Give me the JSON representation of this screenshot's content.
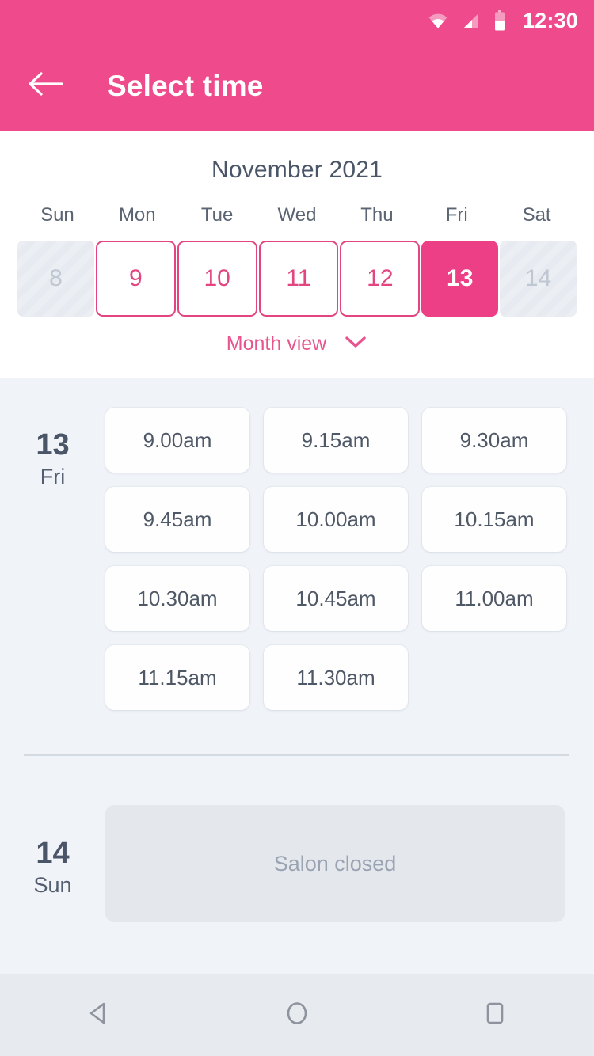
{
  "status_bar": {
    "time": "12:30",
    "icons": [
      "wifi-icon",
      "signal-icon",
      "battery-icon"
    ]
  },
  "app_bar": {
    "back_icon": "back-arrow-icon",
    "title": "Select time"
  },
  "calendar": {
    "month_label": "November 2021",
    "weekdays": [
      "Sun",
      "Mon",
      "Tue",
      "Wed",
      "Thu",
      "Fri",
      "Sat"
    ],
    "days": [
      {
        "number": "8",
        "state": "disabled"
      },
      {
        "number": "9",
        "state": "available"
      },
      {
        "number": "10",
        "state": "available"
      },
      {
        "number": "11",
        "state": "available"
      },
      {
        "number": "12",
        "state": "available"
      },
      {
        "number": "13",
        "state": "selected"
      },
      {
        "number": "14",
        "state": "disabled"
      }
    ],
    "month_view_label": "Month view",
    "month_view_icon": "chevron-down-icon"
  },
  "schedule": {
    "day_groups": [
      {
        "day_number": "13",
        "day_of_week": "Fri",
        "slots": [
          "9.00am",
          "9.15am",
          "9.30am",
          "9.45am",
          "10.00am",
          "10.15am",
          "10.30am",
          "10.45am",
          "11.00am",
          "11.15am",
          "11.30am"
        ]
      }
    ],
    "closed_group": {
      "day_number": "14",
      "day_of_week": "Sun",
      "message": "Salon closed"
    }
  },
  "nav_bar": {
    "buttons": [
      "back-triangle-icon",
      "home-circle-icon",
      "recents-square-icon"
    ]
  },
  "colors": {
    "brand_pink": "#EE4A8C",
    "selected_pink": "#ED3F85",
    "outline_pink": "#E2457F",
    "link_pink": "#E8558E",
    "background": "#F0F3F8",
    "panel_white": "#FFFFFF",
    "text_slate": "#4A5568",
    "slot_text": "#4F5866",
    "disabled_text": "#BFC7D2",
    "closed_card": "#E4E7EC",
    "closed_text": "#9AA3B2",
    "divider": "#D4DAE2",
    "nav_bar": "#E7EAEE"
  }
}
